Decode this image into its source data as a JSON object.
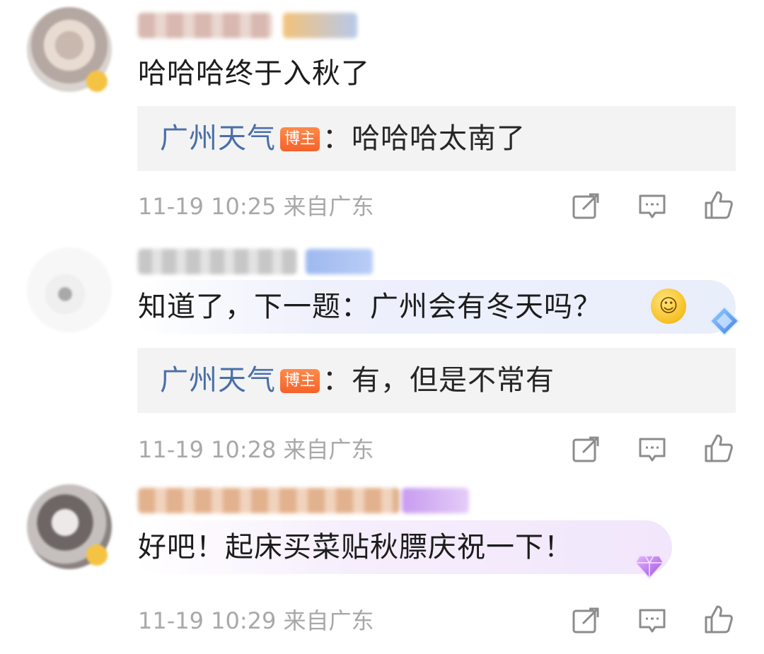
{
  "comments": [
    {
      "text": "哈哈哈终于入秋了",
      "reply": {
        "author": "广州天气",
        "badge": "博主",
        "text": "：哈哈哈太南了"
      },
      "timestamp": "11-19 10:25",
      "location": "来自广东"
    },
    {
      "text": "知道了，下一题：广州会有冬天吗？",
      "emoji": "smiling-face",
      "reply": {
        "author": "广州天气",
        "badge": "博主",
        "text": "：有，但是不常有"
      },
      "timestamp": "11-19 10:28",
      "location": "来自广东"
    },
    {
      "text": "好吧！起床买菜贴秋膘庆祝一下！",
      "timestamp": "11-19 10:29",
      "location": "来自广东"
    }
  ],
  "icons": {
    "share": "share-icon",
    "comment": "comment-icon",
    "like": "thumbs-up-icon",
    "member_blue": "diamond-badge-icon",
    "member_purple": "gem-badge-icon"
  },
  "colors": {
    "reply_name": "#4a6fa8",
    "blogger_badge": "#f4622a",
    "meta_text": "#a8a8a8",
    "reply_bg": "#f3f3f3"
  }
}
